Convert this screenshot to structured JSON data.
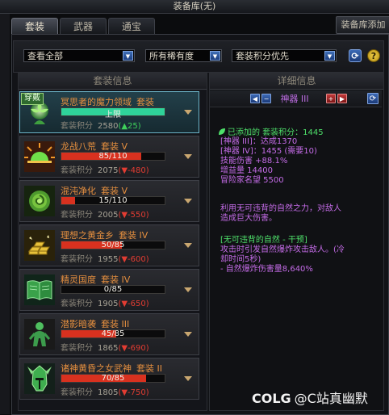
{
  "window": {
    "title": "装备库(无)"
  },
  "tabs": [
    {
      "label": "套装",
      "active": true
    },
    {
      "label": "武器",
      "active": false
    },
    {
      "label": "通宝",
      "active": false
    }
  ],
  "toolbar": {
    "add_label": "装备库添加"
  },
  "filters": {
    "view": "查看全部",
    "rarity": "所有稀有度",
    "sort": "套装积分优先"
  },
  "left_panel": {
    "header": "套装信息"
  },
  "right_panel": {
    "header": "详细信息",
    "nav_title": "神器 III"
  },
  "items": [
    {
      "name": "冥思者的魔力领域",
      "type": "套装",
      "progress_text": "上限",
      "progress_fraction": 1.0,
      "bar_color": "#2fd39a",
      "score_label": "套装积分",
      "score": "2580",
      "delta": "(▲25)",
      "delta_up": true,
      "badge": "穿戴",
      "icon": "glowing-flower-icon",
      "selected": true
    },
    {
      "name": "龙战八荒",
      "type": "套装 V",
      "progress_text": "85/110",
      "progress_fraction": 0.773,
      "bar_color": "#d8311f",
      "score_label": "套装积分",
      "score": "2075",
      "delta": "(▼-480)",
      "delta_up": false,
      "icon": "rising-sun-icon",
      "selected": false
    },
    {
      "name": "混沌净化",
      "type": "套装 V",
      "progress_text": "15/110",
      "progress_fraction": 0.136,
      "bar_color": "#d8311f",
      "score_label": "套装积分",
      "score": "2005",
      "delta": "(▼-550)",
      "delta_up": false,
      "icon": "green-rose-icon",
      "selected": false
    },
    {
      "name": "理想之黄金乡",
      "type": "套装 IV",
      "progress_text": "50/85",
      "progress_fraction": 0.588,
      "bar_color": "#d8311f",
      "score_label": "套装积分",
      "score": "1955",
      "delta": "(▼-600)",
      "delta_up": false,
      "icon": "gold-bars-icon",
      "selected": false
    },
    {
      "name": "精灵国度",
      "type": "套装 IV",
      "progress_text": "0/85",
      "progress_fraction": 0.0,
      "bar_color": "#d8311f",
      "score_label": "套装积分",
      "score": "1905",
      "delta": "(▼-650)",
      "delta_up": false,
      "icon": "open-book-icon",
      "selected": false
    },
    {
      "name": "潜影暗袭",
      "type": "套装 III",
      "progress_text": "45/85",
      "progress_fraction": 0.529,
      "bar_color": "#d8311f",
      "score_label": "套装积分",
      "score": "1865",
      "delta": "(▼-690)",
      "delta_up": false,
      "icon": "shadow-figure-icon",
      "selected": false
    },
    {
      "name": "诸神黄昏之女武神",
      "type": "套装 II",
      "progress_text": "70/85",
      "progress_fraction": 0.824,
      "bar_color": "#d8311f",
      "score_label": "套装积分",
      "score": "1805",
      "delta": "(▼-750)",
      "delta_up": false,
      "icon": "valkyrie-helmet-icon",
      "selected": false
    }
  ],
  "details": [
    {
      "text": "已添加的 套装积分：1445",
      "color": "#4ee06a",
      "icon": "leaf-icon"
    },
    {
      "text": "[神器 III]：达成1370",
      "color": "#c56ce8"
    },
    {
      "text": "[神器 IV]：1455 (需要10)",
      "color": "#c56ce8"
    },
    {
      "text": "技能伤害 +88.1%",
      "color": "#c56ce8"
    },
    {
      "text": "增益量 14400",
      "color": "#c56ce8"
    },
    {
      "text": "冒险家名望 5500",
      "color": "#c56ce8"
    },
    {
      "text": "利用无可违背的自然之力，对敌人",
      "color": "#c56ce8"
    },
    {
      "text": "造成巨大伤害。",
      "color": "#c56ce8"
    },
    {
      "text": "[无可违背的自然 - 干预]",
      "color": "#4ee06a"
    },
    {
      "text": "攻击时引发自然爆炸攻击敌人。(冷",
      "color": "#c56ce8"
    },
    {
      "text": "却时间5秒)",
      "color": "#c56ce8"
    },
    {
      "text": "- 自然爆炸伤害量8,640%",
      "color": "#c56ce8"
    }
  ],
  "watermark": {
    "logo": "COLG",
    "text": "@C站真幽默"
  }
}
